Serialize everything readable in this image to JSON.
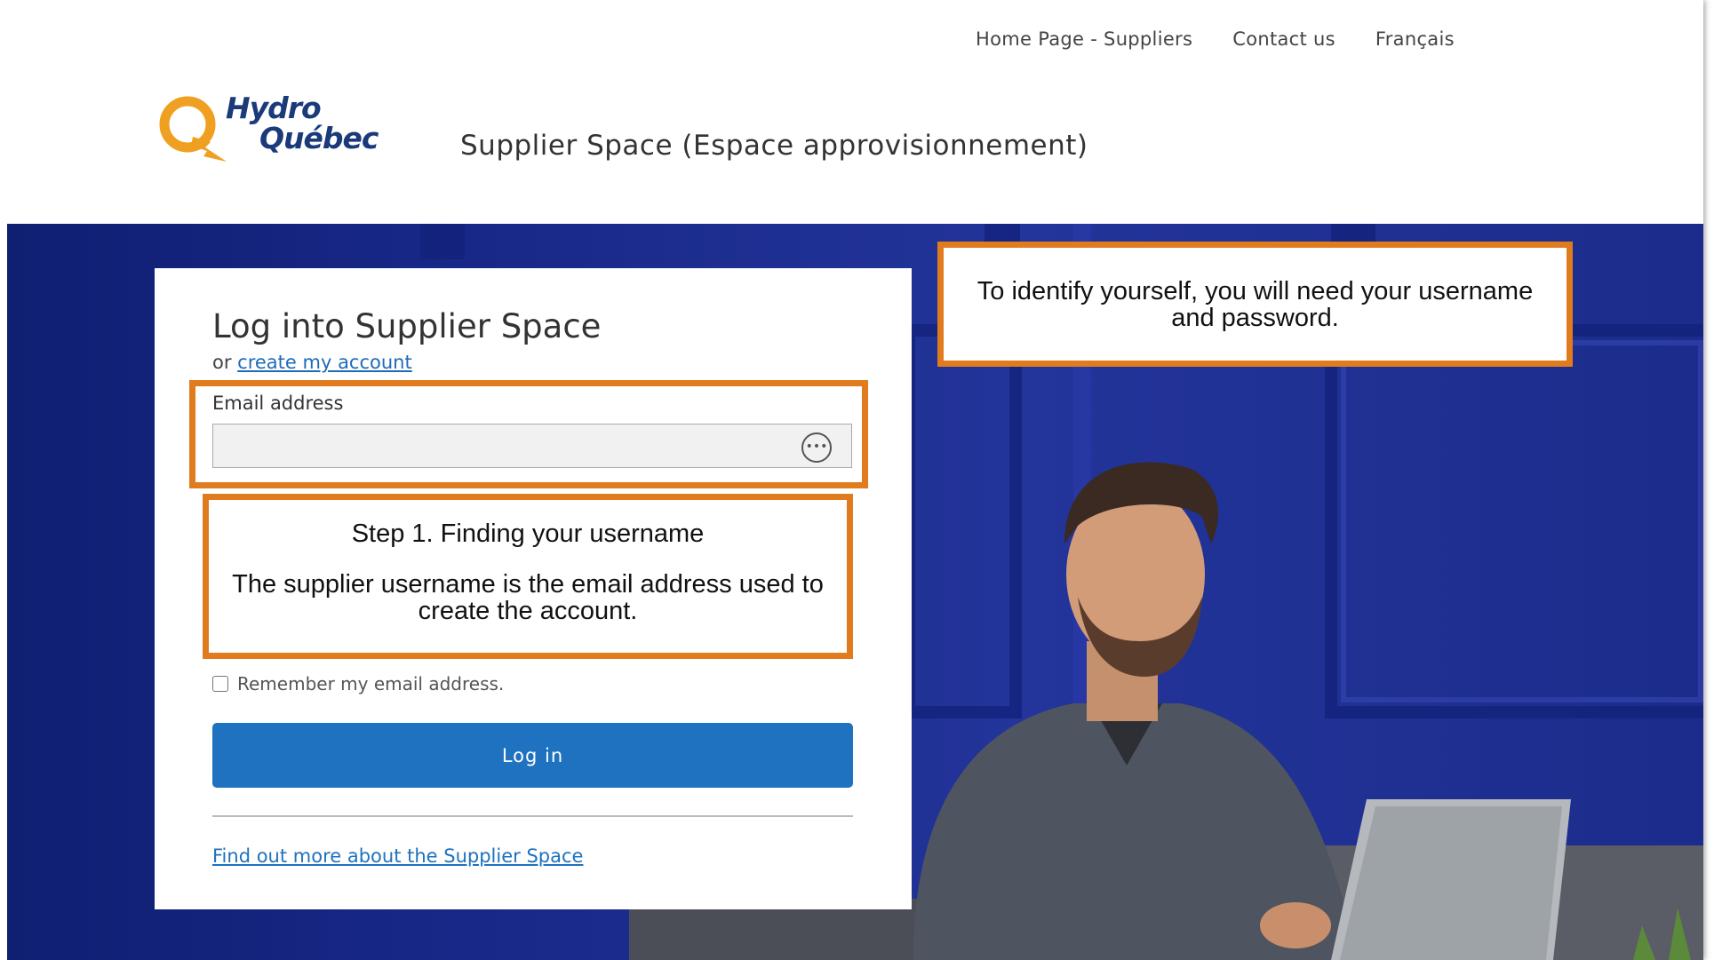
{
  "header": {
    "nav": [
      "Home Page - Suppliers",
      "Contact us",
      "Français"
    ],
    "logo_line1": "Hydro",
    "logo_line2": "Québec",
    "site_title": "Supplier Space (Espace approvisionnement)"
  },
  "login": {
    "title": "Log into Supplier Space",
    "or_text": "or ",
    "create_account_link": "create my account",
    "email_label": "Email address",
    "email_value": "",
    "email_icon": "ellipsis-circle-icon",
    "remember_label": "Remember my email address.",
    "login_button": "Log in",
    "more_link": "Find out more about the Supplier Space"
  },
  "callouts": {
    "step1_title": "Step 1. Finding your username",
    "step1_body": "The supplier username is the email address used to create the account.",
    "identify_text": "To identify yourself, you will need your username and password."
  },
  "colors": {
    "accent_orange": "#e07b1e",
    "brand_blue": "#1a3a7a",
    "button_blue": "#1e72bf",
    "hero_blue": "#19298a"
  }
}
